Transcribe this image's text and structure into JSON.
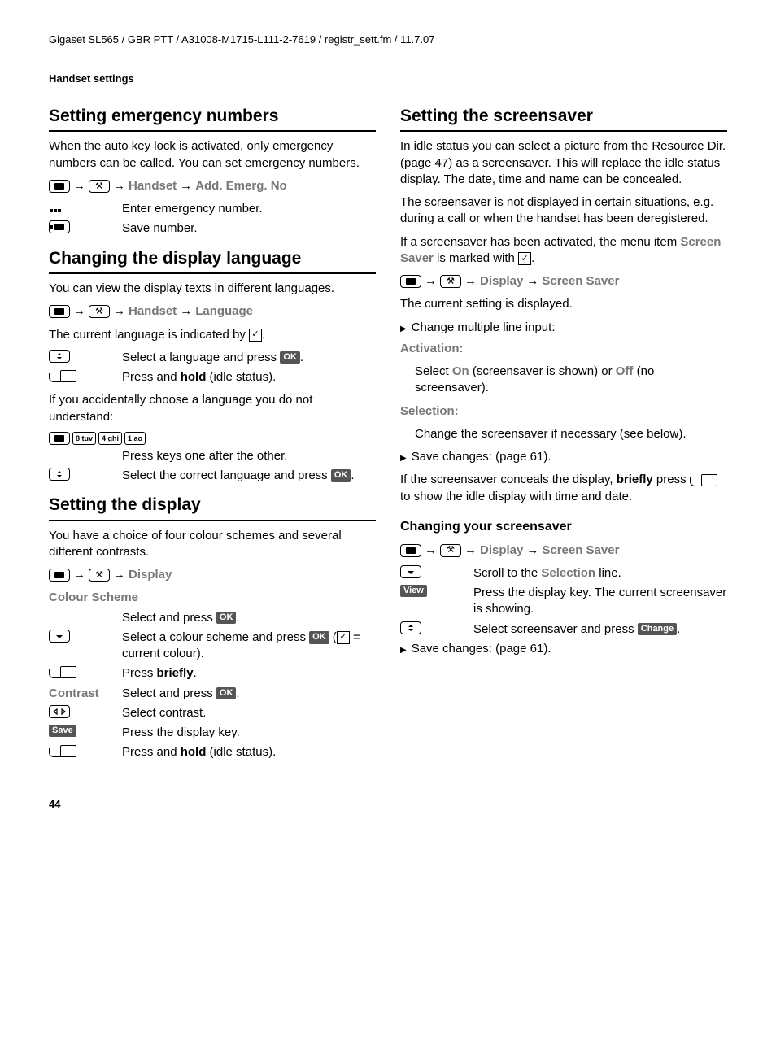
{
  "header_path": "Gigaset SL565 / GBR PTT / A31008-M1715-L111-2-7619 / registr_sett.fm / 11.7.07",
  "section_title": "Handset settings",
  "page_number": "44",
  "left": {
    "h1_emergency": "Setting emergency numbers",
    "emergency_intro": "When the auto key lock is activated, only emergency numbers can be called. You can set emergency numbers.",
    "emergency_path": {
      "a": "Handset",
      "b": "Add. Emerg. No"
    },
    "emergency_row1": "Enter emergency number.",
    "emergency_row2": "Save number.",
    "h1_lang": "Changing the display language",
    "lang_intro": "You can view the display texts in different languages.",
    "lang_path": {
      "a": "Handset",
      "b": "Language"
    },
    "lang_current_pre": "The current language is indicated by ",
    "lang_current_post": ".",
    "lang_row1_a": "Select a language and press ",
    "lang_row1_b": ".",
    "lang_row2_a": "Press and ",
    "lang_row2_bold": "hold",
    "lang_row2_b": " (idle status).",
    "lang_accident": "If you accidentally choose a language you do not understand:",
    "lang_keys_note": "Press keys one after the other.",
    "lang_row3_a": "Select the correct language and press ",
    "lang_row3_b": ".",
    "h1_display": "Setting the display",
    "display_intro": "You have a choice of four colour schemes and several different contrasts.",
    "display_path": {
      "a": "Display"
    },
    "colour_label": "Colour Scheme",
    "colour_row1_a": "Select and press ",
    "colour_row1_b": ".",
    "colour_row2_a": "Select a colour scheme and press ",
    "colour_row2_b": " (",
    "colour_row2_c": " = current colour).",
    "colour_row3_a": "Press ",
    "colour_row3_bold": "briefly",
    "colour_row3_b": ".",
    "contrast_label": "Contrast",
    "contrast_row1_a": "Select and press ",
    "contrast_row1_b": ".",
    "contrast_row2": "Select contrast.",
    "save_label": "Save",
    "contrast_row3": "Press the display key.",
    "contrast_row4_a": "Press and ",
    "contrast_row4_bold": "hold",
    "contrast_row4_b": " (idle status)."
  },
  "right": {
    "h1_ss": "Setting the screensaver",
    "ss_p1": "In idle status you can select a picture from the Resource Dir. (page 47) as a screensaver. This will replace the idle status display. The date, time and name can be concealed.",
    "ss_p2": "The screensaver is not displayed in certain situations, e.g. during a call or when the handset has been deregistered.",
    "ss_p3_a": "If a screensaver has been activated, the menu item ",
    "ss_p3_label": "Screen Saver",
    "ss_p3_b": " is marked with ",
    "ss_p3_c": ".",
    "ss_path": {
      "a": "Display",
      "b": "Screen Saver"
    },
    "ss_current": "The current setting is displayed.",
    "ss_bullet1": "Change multiple line input:",
    "activation_label": "Activation:",
    "activation_a": "Select ",
    "activation_on": "On",
    "activation_b": " (screensaver is shown) or ",
    "activation_off": "Off",
    "activation_c": " (no screensaver).",
    "selection_label": "Selection:",
    "selection_text": "Change the screensaver if necessary (see below).",
    "ss_bullet2": "Save changes: (page 61).",
    "ss_conceal_a": "If the screensaver conceals the display, ",
    "ss_conceal_bold": "briefly",
    "ss_conceal_b": " press ",
    "ss_conceal_c": " to show the idle display with time and date.",
    "h2_change": "Changing your screensaver",
    "change_path": {
      "a": "Display",
      "b": "Screen Saver"
    },
    "change_row1_a": "Scroll to the ",
    "change_row1_label": "Selection",
    "change_row1_b": " line.",
    "view_label": "View",
    "change_row2": "Press the display key. The current screensaver is showing.",
    "change_row3_a": "Select screensaver and press ",
    "change_label": "Change",
    "change_row3_b": ".",
    "change_bullet": "Save changes: (page 61)."
  },
  "keys": {
    "k8": "8 tuv",
    "k4": "4 ghi",
    "k1": "1 ao"
  },
  "ok": "OK"
}
